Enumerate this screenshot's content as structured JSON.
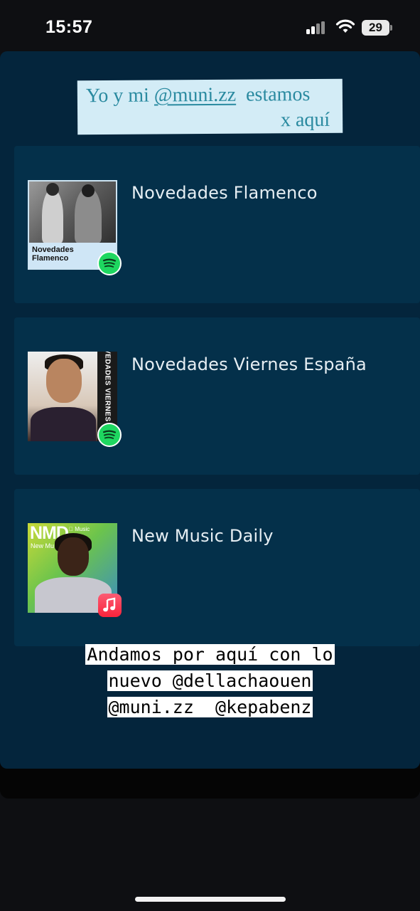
{
  "status_bar": {
    "time": "15:57",
    "battery": "29"
  },
  "sticker": {
    "line1_prefix": "Yo y mi ",
    "line1_handle": "@muni.zz",
    "line1_suffix": "  estamos",
    "line2": "x aquí",
    "bg_color": "#d3ecf6",
    "text_color": "#2a8aa0"
  },
  "playlists": [
    {
      "title": "Novedades Flamenco",
      "cover_text": "Novedades\nFlamenco",
      "service_icon": "spotify-icon"
    },
    {
      "title": "Novedades Viernes España",
      "cover_text": "NOVEDADES VIERNES ESPAÑA",
      "service_icon": "spotify-icon"
    },
    {
      "title": "New Music Daily",
      "cover_logo": "NMD",
      "cover_subtitle": "New Mu",
      "cover_service": "Music",
      "service_icon": "apple-music-icon"
    }
  ],
  "caption": {
    "line1": "Andamos por aquí con lo",
    "line2": "nuevo @dellachaouen",
    "line3": "@muni.zz  @kepabenz"
  },
  "colors": {
    "panel": "#04253c",
    "card": "#04304a",
    "spotify": "#1ed760",
    "apple_music": "#fa233b"
  }
}
